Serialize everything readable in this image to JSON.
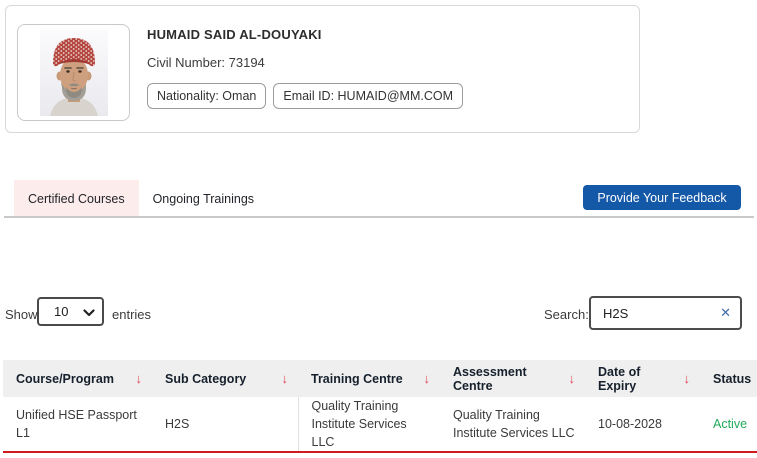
{
  "profile": {
    "name": "HUMAID SAID AL-DOUYAKI",
    "civil_number_label": "Civil Number:",
    "civil_number": "73194",
    "nationality_badge": "Nationality: Oman",
    "email_badge": "Email ID: HUMAID@MM.COM",
    "photo_alt": "portrait-photo-of-man-with-omani-kumma"
  },
  "tabs": [
    {
      "label": "Certified Courses",
      "active": true
    },
    {
      "label": "Ongoing Trainings",
      "active": false
    }
  ],
  "feedback_button_label": "Provide Your Feedback",
  "table_controls": {
    "show_label": "Show",
    "page_size": "10",
    "entries_label": "entries",
    "search_label": "Search:",
    "search_value": "H2S"
  },
  "icons": {
    "sort_arrow": "↓",
    "clear_search": "✕",
    "select_chevron": "chevron-down"
  },
  "table": {
    "headers": [
      {
        "label": "Course/Program",
        "sortable": true
      },
      {
        "label": "Sub Category",
        "sortable": true
      },
      {
        "label": "Training Centre",
        "sortable": true
      },
      {
        "label": "Assessment Centre",
        "sortable": true
      },
      {
        "label": "Date of Expiry",
        "sortable": true
      },
      {
        "label": "Status",
        "sortable": false
      }
    ],
    "rows": [
      {
        "course": "Unified HSE Passport L1",
        "sub_category": "H2S",
        "training_centre": "Quality Training Institute Services LLC",
        "assessment_centre": "Quality Training Institute Services LLC",
        "date_of_expiry": "10-08-2028",
        "status": "Active"
      }
    ]
  },
  "colors": {
    "accent_blue": "#1458a8",
    "tab_active_bg": "#fdecec",
    "sort_arrow_red": "#e34257",
    "row_border_red": "#cf1a1f",
    "status_active_green": "#22a95a",
    "header_bg": "#efefef"
  }
}
